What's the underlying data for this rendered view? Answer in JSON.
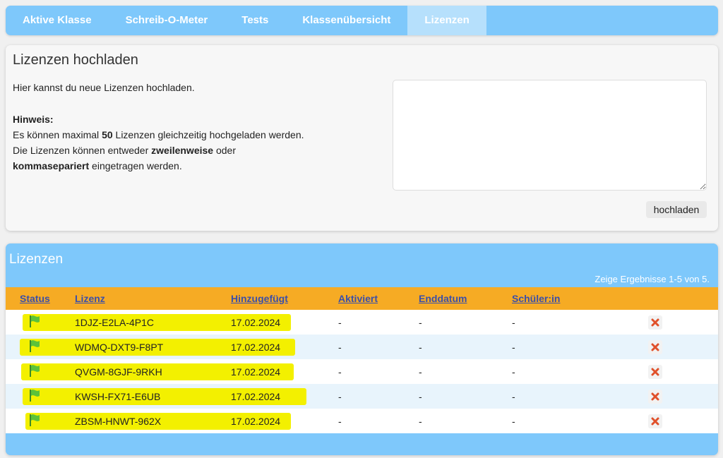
{
  "nav": {
    "tabs": [
      {
        "label": "Aktive Klasse"
      },
      {
        "label": "Schreib-O-Meter"
      },
      {
        "label": "Tests"
      },
      {
        "label": "Klassenübersicht"
      },
      {
        "label": "Lizenzen"
      }
    ],
    "active_index": 4
  },
  "upload": {
    "title": "Lizenzen hochladen",
    "intro": "Hier kannst du neue Lizenzen hochladen.",
    "hint_title": "Hinweis:",
    "hint_line1_pre": "Es können maximal ",
    "hint_line1_bold": "50",
    "hint_line1_post": " Lizenzen gleichzeitig hochgeladen werden.",
    "hint_line2_pre": "Die Lizenzen können entweder ",
    "hint_line2_bold": "zweilenweise",
    "hint_line2_post": " oder",
    "hint_line3_bold": "kommasepariert",
    "hint_line3_post": " eingetragen werden.",
    "textarea_value": "",
    "button_label": "hochladen"
  },
  "licenses": {
    "title": "Lizenzen",
    "result_count": "Zeige Ergebnisse 1-5 von 5.",
    "columns": [
      "Status",
      "Lizenz",
      "Hinzugefügt",
      "Aktiviert",
      "Enddatum",
      "Schüler:in"
    ],
    "rows": [
      {
        "license": "1DJZ-E2LA-4P1C",
        "added": "17.02.2024",
        "activated": "-",
        "end_date": "-",
        "student": "-"
      },
      {
        "license": "WDMQ-DXT9-F8PT",
        "added": "17.02.2024",
        "activated": "-",
        "end_date": "-",
        "student": "-"
      },
      {
        "license": "QVGM-8GJF-9RKH",
        "added": "17.02.2024",
        "activated": "-",
        "end_date": "-",
        "student": "-"
      },
      {
        "license": "KWSH-FX71-E6UB",
        "added": "17.02.2024",
        "activated": "-",
        "end_date": "-",
        "student": "-"
      },
      {
        "license": "ZBSM-HNWT-962X",
        "added": "17.02.2024",
        "activated": "-",
        "end_date": "-",
        "student": "-"
      }
    ]
  },
  "colors": {
    "nav_bg": "#7ec8fb",
    "nav_active": "#b6e0fc",
    "table_header": "#f6ab24",
    "header_link": "#3b4fa8",
    "highlight": "#f3f000",
    "status_flag": "#5cc23a",
    "delete_icon": "#e0502a"
  },
  "icons": {
    "status": "green-flag-icon",
    "delete": "delete-x-icon"
  }
}
